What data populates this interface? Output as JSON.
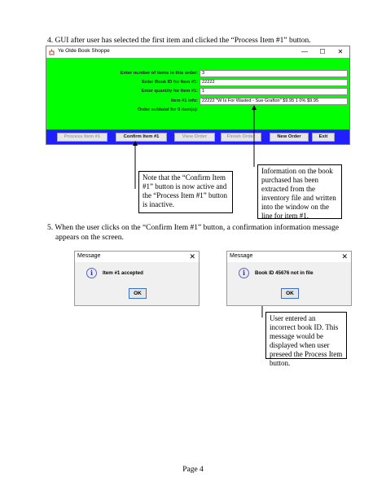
{
  "step4": {
    "text": "4. GUI after user has selected the first item and clicked the “Process Item #1” button."
  },
  "window": {
    "title": "Ye Olde Book Shoppe",
    "controls": {
      "minimize": "—",
      "maximize": "☐",
      "close": "✕"
    },
    "rows": [
      {
        "label": "Enter number of items in this order:",
        "value": "3"
      },
      {
        "label": "Enter Book ID for Item #1:",
        "value": "22222"
      },
      {
        "label": "Enter quantity for Item #1:",
        "value": "1"
      },
      {
        "label": "Item #1 info:",
        "value": "22222 \"W Is For Wasted - Sue Grafton\" $9.95 1 0% $9.95"
      },
      {
        "label": "Order subtotal for 0 item(s):",
        "value": ""
      }
    ],
    "buttons": [
      {
        "label": "Process Item #1",
        "state": "inactive"
      },
      {
        "label": "Confirm Item #1",
        "state": "active"
      },
      {
        "label": "View Order",
        "state": "inactive"
      },
      {
        "label": "Finish Order",
        "state": "inactive"
      },
      {
        "label": "New Order",
        "state": "active"
      },
      {
        "label": "Exit",
        "state": "active"
      }
    ],
    "colors": {
      "panel": "#00ff00",
      "button_bar": "#1f1fff"
    }
  },
  "notes": {
    "confirm": "Note that the “Confirm Item #1” button is now active and the “Process Item #1” button is inactive.",
    "info": "Information on the book purchased has been extracted from the inventory file and written into the window on the line for item #1.",
    "incorrect": "User entered an incorrect book ID.  This message would be displayed when user preseed the Process Item button."
  },
  "step5": {
    "line1": "5. When the user clicks on the “Confirm Item #1” button, a confirmation information message",
    "line2": "appears on the screen."
  },
  "dialogs": [
    {
      "title": "Message",
      "close": "✕",
      "icon": "i",
      "message": "Item #1 accepted",
      "ok": "OK"
    },
    {
      "title": "Message",
      "close": "✕",
      "icon": "i",
      "message": "Book ID 45676 not in file",
      "ok": "OK"
    }
  ],
  "page": {
    "number": "Page 4"
  }
}
